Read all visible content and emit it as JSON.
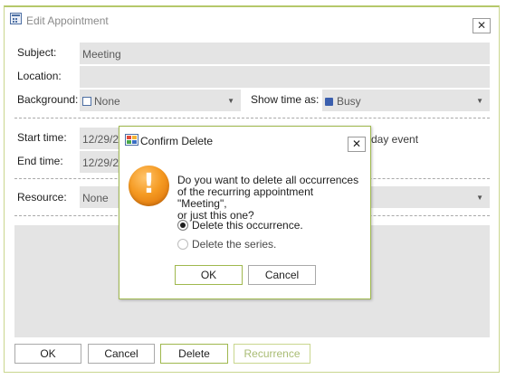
{
  "window": {
    "title": "Edit Appointment",
    "close_glyph": "✕"
  },
  "form": {
    "subject_label": "Subject:",
    "subject_value": "Meeting",
    "location_label": "Location:",
    "location_value": "",
    "background_label": "Background:",
    "background_value": "None",
    "show_time_label": "Show time as:",
    "show_time_value": "Busy",
    "start_label": "Start time:",
    "start_value": "12/29/2",
    "end_label": "End time:",
    "end_value": "12/29/2",
    "all_day_fragment": "day event",
    "resource_label": "Resource:",
    "resource_value": "None",
    "dropdown_glyph": "▼"
  },
  "buttons": {
    "ok": "OK",
    "cancel": "Cancel",
    "delete": "Delete",
    "recurrence": "Recurrence"
  },
  "dialog": {
    "title": "Confirm Delete",
    "close_glyph": "✕",
    "icon_glyph": "!",
    "message_line1": "Do you want to delete all occurrences",
    "message_line2": "of the recurring appointment \"Meeting\",",
    "message_line3": "or just this one?",
    "option_occurrence": "Delete this occurrence.",
    "option_series": "Delete the series.",
    "selected_option": "occurrence",
    "ok": "OK",
    "cancel": "Cancel"
  },
  "colors": {
    "accent_green": "#9fb84e",
    "busy_blue": "#3b5fae",
    "field_gray": "#e4e4e4",
    "warning_orange": "#f59a22"
  }
}
